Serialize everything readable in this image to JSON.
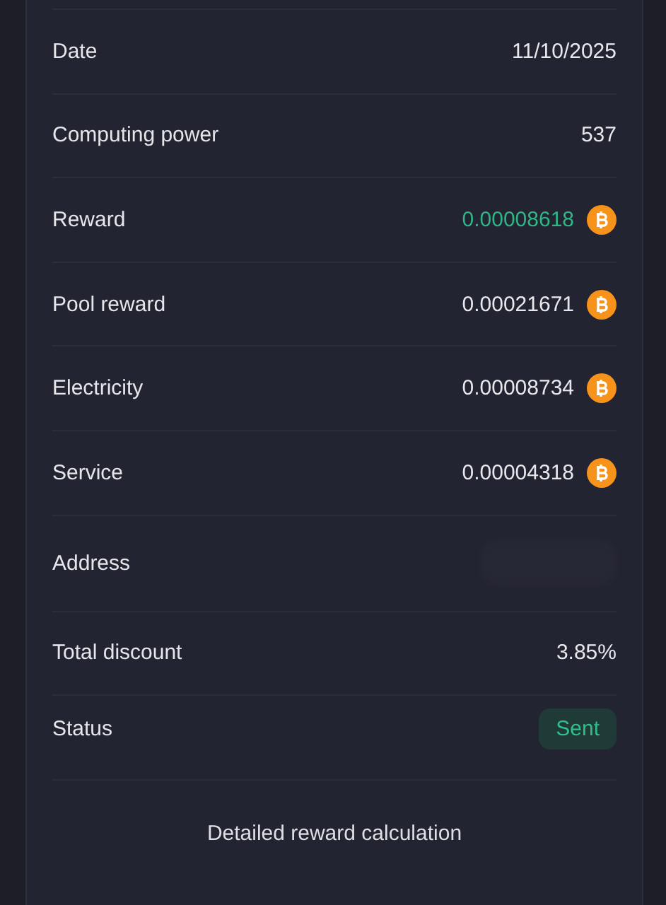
{
  "rows": [
    {
      "label": "Date",
      "kind": "text",
      "value": "11/10/2025"
    },
    {
      "label": "Computing power",
      "kind": "text",
      "value": "537"
    },
    {
      "label": "Reward",
      "kind": "coin",
      "value": "0.00008618",
      "highlighted": true
    },
    {
      "label": "Pool reward",
      "kind": "coin",
      "value": "0.00021671",
      "highlighted": false
    },
    {
      "label": "Electricity",
      "kind": "coin",
      "value": "0.00008734",
      "highlighted": false
    },
    {
      "label": "Service",
      "kind": "coin",
      "value": "0.00004318",
      "highlighted": false
    },
    {
      "label": "Address",
      "kind": "hidden"
    },
    {
      "label": "Total discount",
      "kind": "text",
      "value": "3.85%"
    },
    {
      "label": "Status",
      "kind": "badge",
      "value": "Sent"
    }
  ],
  "action": {
    "label": "Detailed reward calculation"
  }
}
